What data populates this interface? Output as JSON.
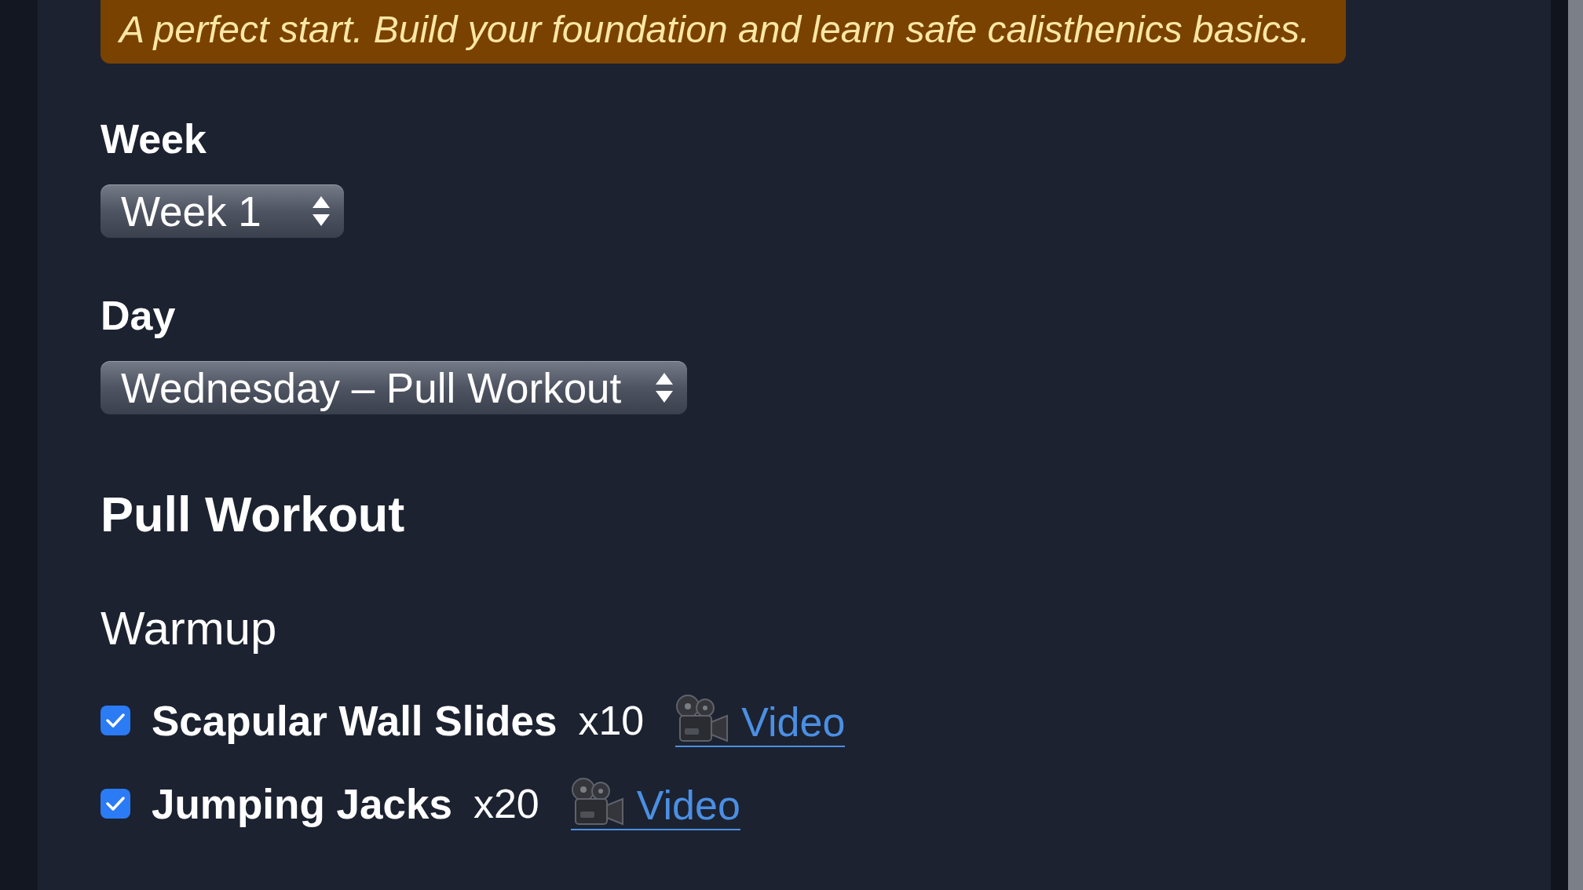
{
  "banner": {
    "text": "A perfect start. Build your foundation and learn safe calisthenics basics."
  },
  "filters": [
    {
      "label": "Week",
      "value": "Week 1"
    },
    {
      "label": "Day",
      "value": "Wednesday – Pull Workout"
    }
  ],
  "workout": {
    "title": "Pull Workout",
    "sections": [
      {
        "title": "Warmup",
        "exercises": [
          {
            "name": "Scapular Wall Slides",
            "reps": "x10",
            "checked": true,
            "link": "Video"
          },
          {
            "name": "Jumping Jacks",
            "reps": "x20",
            "checked": true,
            "link": "Video"
          }
        ]
      }
    ]
  }
}
